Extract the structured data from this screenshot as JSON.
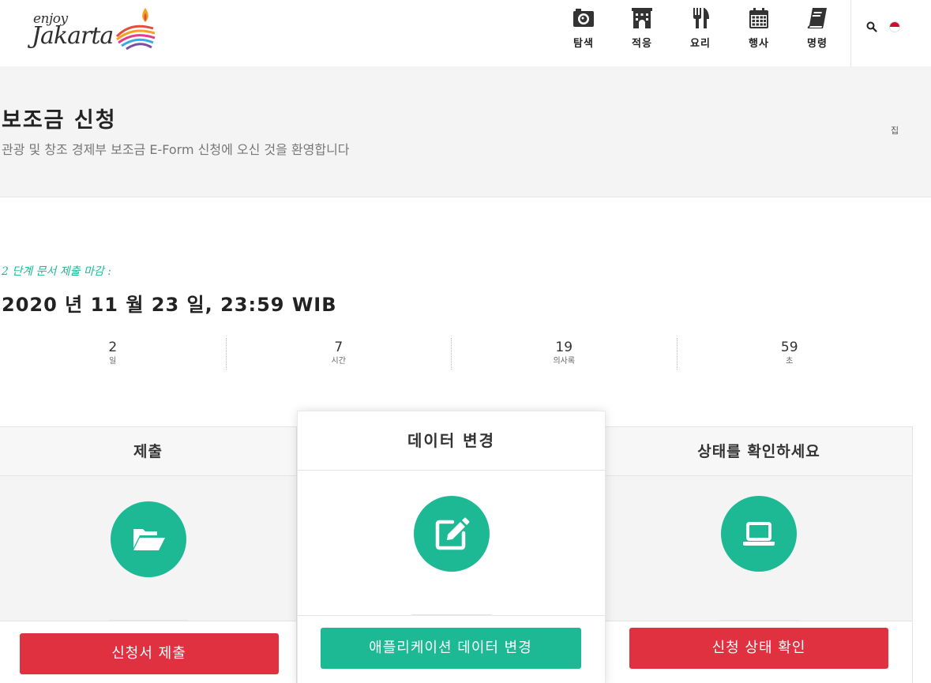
{
  "header": {
    "logo": {
      "enjoy": "enjoy",
      "jakarta": "Jakarta"
    },
    "nav": [
      {
        "label": "탐색",
        "icon": "camera-icon"
      },
      {
        "label": "적응",
        "icon": "hotel-icon"
      },
      {
        "label": "요리",
        "icon": "cutlery-icon"
      },
      {
        "label": "행사",
        "icon": "calendar-icon"
      },
      {
        "label": "명령",
        "icon": "book-icon"
      }
    ],
    "search_icon": "search-icon",
    "language_flag": "indonesia-flag-icon"
  },
  "banner": {
    "title": "보조금 신청",
    "subtitle": "관광 및 창조 경제부 보조금 E-Form 신청에 오신 것을 환영합니다",
    "breadcrumb": "집"
  },
  "deadline": {
    "label": "2 단계 문서 제출 마감 :",
    "date": "2020 년 11 월 23 일, 23:59 WIB"
  },
  "countdown": [
    {
      "value": "2",
      "unit": "일"
    },
    {
      "value": "7",
      "unit": "시간"
    },
    {
      "value": "19",
      "unit": "의사록"
    },
    {
      "value": "59",
      "unit": "초"
    }
  ],
  "cards": {
    "submit": {
      "title": "제출",
      "icon": "folder-open-icon",
      "button": "신청서 제출"
    },
    "change": {
      "title": "데이터 변경",
      "icon": "edit-icon",
      "button": "애플리케이션 데이터 변경"
    },
    "status": {
      "title": "상태를 확인하세요",
      "icon": "laptop-icon",
      "button": "신청 상태 확인"
    }
  },
  "colors": {
    "accent_green": "#1db995",
    "button_red": "#e03140",
    "banner_bg": "#f4f4f4",
    "flag_red": "#c8102e"
  }
}
